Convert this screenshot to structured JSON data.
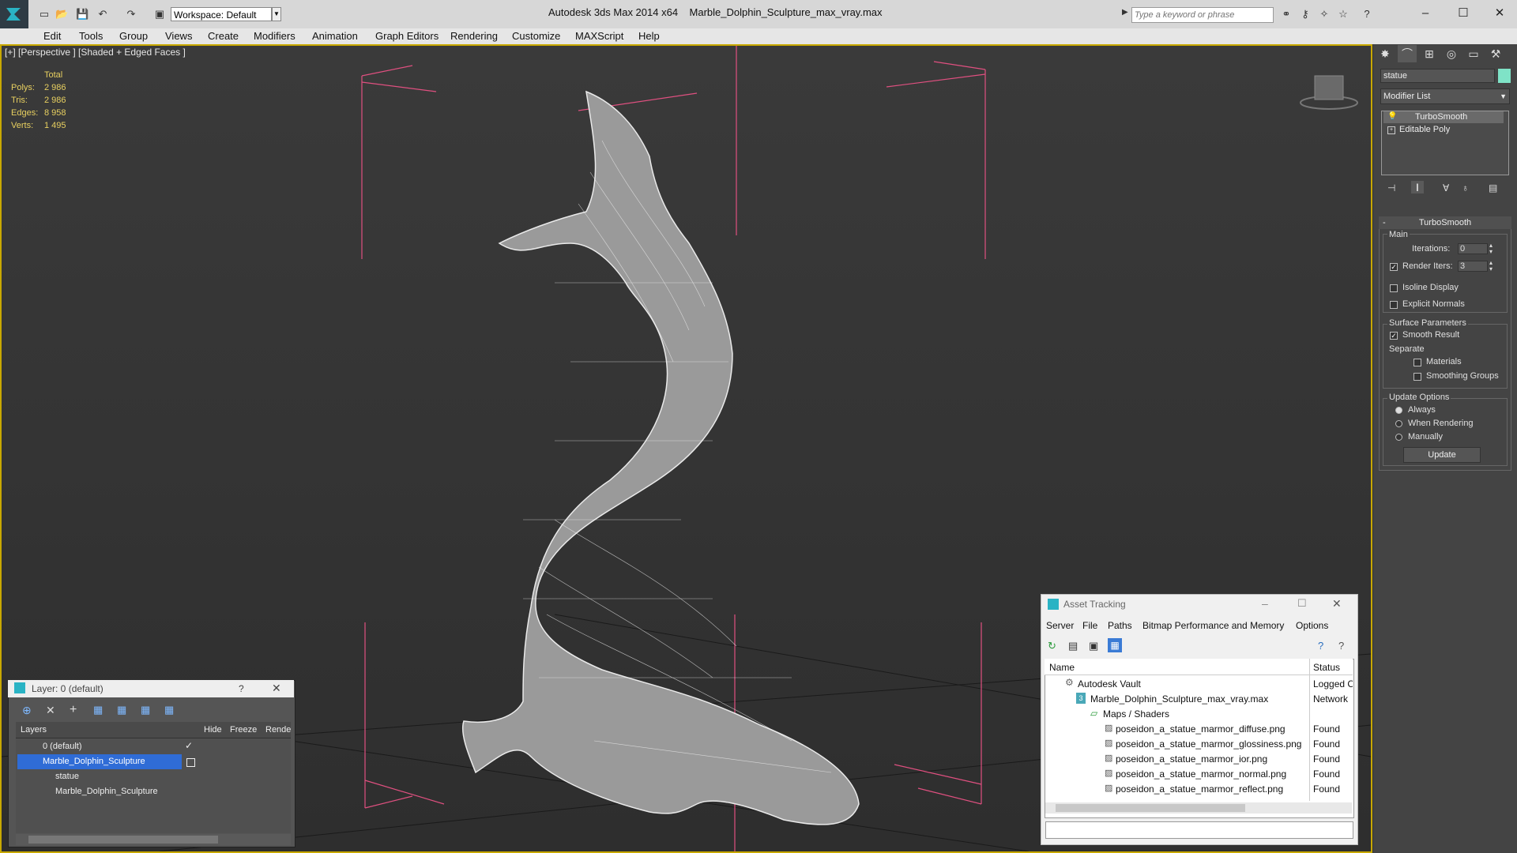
{
  "app": {
    "title": "Autodesk 3ds Max  2014 x64",
    "filename": "Marble_Dolphin_Sculpture_max_vray.max",
    "workspace": "Workspace: Default",
    "search_placeholder": "Type a keyword or phrase"
  },
  "menu": [
    "Edit",
    "Tools",
    "Group",
    "Views",
    "Create",
    "Modifiers",
    "Animation",
    "Graph Editors",
    "Rendering",
    "Customize",
    "MAXScript",
    "Help"
  ],
  "viewport": {
    "label": "[+] [Perspective ] [Shaded + Edged Faces ]",
    "stats": {
      "header": "Total",
      "rows": [
        {
          "label": "Polys:",
          "value": "2 986"
        },
        {
          "label": "Tris:",
          "value": "2 986"
        },
        {
          "label": "Edges:",
          "value": "8 958"
        },
        {
          "label": "Verts:",
          "value": "1 495"
        }
      ]
    }
  },
  "command_panel": {
    "object_name": "statue",
    "object_color": "#7fe3c7",
    "modifier_list": "Modifier List",
    "stack": [
      "TurboSmooth",
      "Editable Poly"
    ],
    "rollout_title": "TurboSmooth",
    "main_group": "Main",
    "iterations_label": "Iterations:",
    "iterations_value": "0",
    "render_iters_label": "Render Iters:",
    "render_iters_value": "3",
    "isoline": "Isoline Display",
    "explicit": "Explicit Normals",
    "surface_group": "Surface Parameters",
    "smooth_result": "Smooth Result",
    "separate": "Separate",
    "materials": "Materials",
    "smoothing_groups": "Smoothing Groups",
    "update_group": "Update Options",
    "always": "Always",
    "when_rendering": "When Rendering",
    "manually": "Manually",
    "update_button": "Update"
  },
  "layer_window": {
    "title": "Layer: 0 (default)",
    "help": "?",
    "columns": [
      "Layers",
      "Hide",
      "Freeze",
      "Rende"
    ],
    "rows": [
      "0 (default)",
      "Marble_Dolphin_Sculpture",
      "statue",
      "Marble_Dolphin_Sculpture"
    ]
  },
  "asset_tracking": {
    "title": "Asset Tracking",
    "menu": [
      "Server",
      "File",
      "Paths",
      "Bitmap Performance and Memory",
      "Options"
    ],
    "columns": [
      "Name",
      "Status"
    ],
    "rows": [
      {
        "name": "Autodesk Vault",
        "status": "Logged C"
      },
      {
        "name": "Marble_Dolphin_Sculpture_max_vray.max",
        "status": "Network"
      },
      {
        "name": "Maps / Shaders",
        "status": ""
      },
      {
        "name": "poseidon_a_statue_marmor_diffuse.png",
        "status": "Found"
      },
      {
        "name": "poseidon_a_statue_marmor_glossiness.png",
        "status": "Found"
      },
      {
        "name": "poseidon_a_statue_marmor_ior.png",
        "status": "Found"
      },
      {
        "name": "poseidon_a_statue_marmor_normal.png",
        "status": "Found"
      },
      {
        "name": "poseidon_a_statue_marmor_reflect.png",
        "status": "Found"
      }
    ]
  }
}
